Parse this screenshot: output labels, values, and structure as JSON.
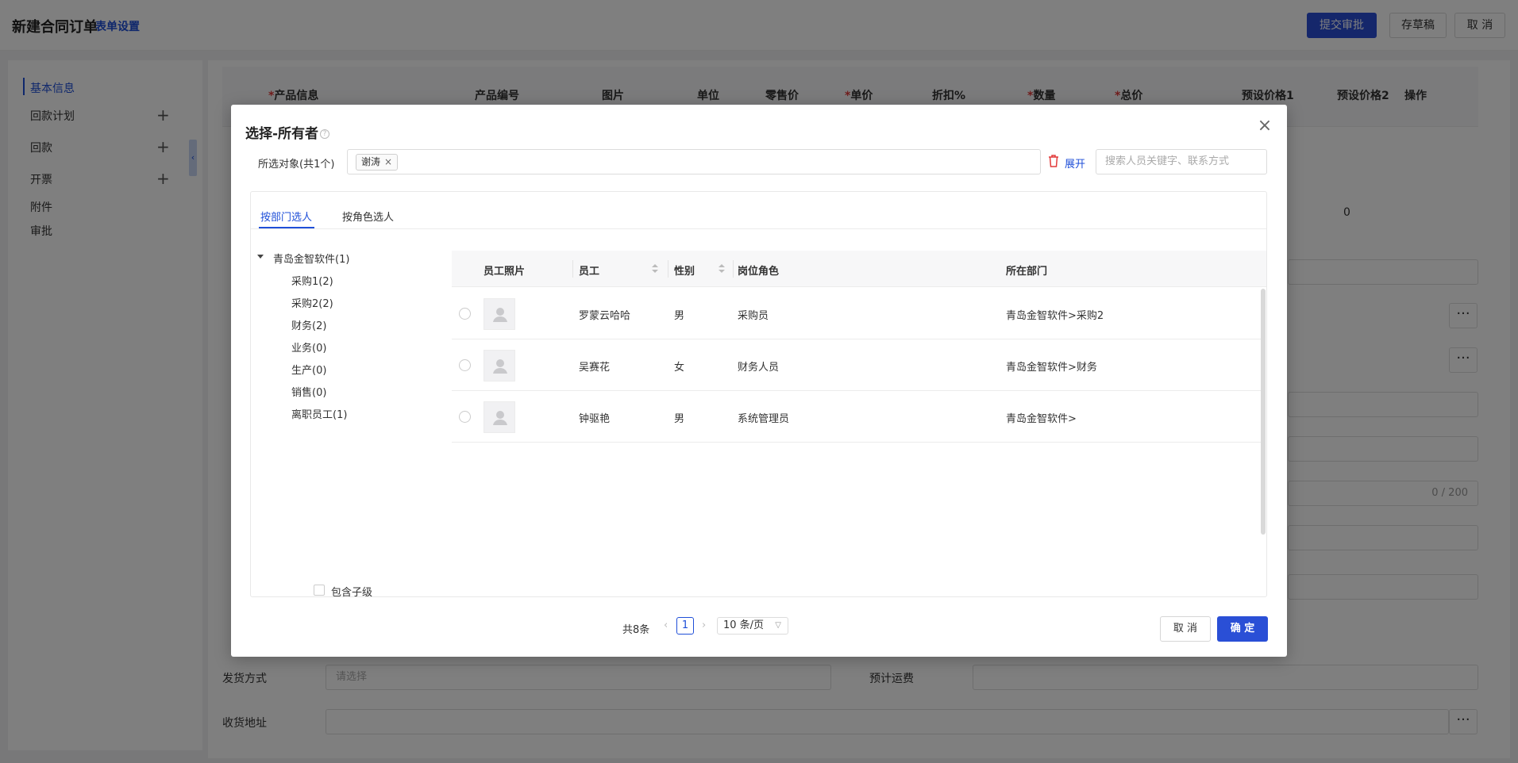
{
  "page": {
    "title": "新建合同订单",
    "form_settings": "表单设置",
    "actions": {
      "submit": "提交审批",
      "draft": "存草稿",
      "cancel": "取 消"
    }
  },
  "sidebar": {
    "items": [
      {
        "label": "基本信息",
        "active": true
      },
      {
        "label": "回款计划",
        "plus": true
      },
      {
        "label": "回款",
        "plus": true
      },
      {
        "label": "开票",
        "plus": true
      },
      {
        "label": "附件"
      },
      {
        "label": "审批"
      }
    ]
  },
  "product_table": {
    "headers": [
      "产品信息",
      "产品编号",
      "图片",
      "单位",
      "零售价",
      "单价",
      "折扣%",
      "数量",
      "总价",
      "预设价格1",
      "预设价格2",
      "操作"
    ],
    "row2_value": "0"
  },
  "background_form": {
    "shipping_method_label": "发货方式",
    "shipping_method_placeholder": "请选择",
    "estimated_freight_label": "预计运费",
    "receiving_address_label": "收货地址",
    "char_counter": "0 / 200"
  },
  "dialog": {
    "title": "选择-所有者",
    "selected_label": "所选对象(共1个)",
    "selected_tags": [
      "谢涛"
    ],
    "expand_label": "展开",
    "search_placeholder": "搜索人员关键字、联系方式",
    "tabs": [
      {
        "label": "按部门选人",
        "active": true
      },
      {
        "label": "按角色选人",
        "active": false
      }
    ],
    "tree": {
      "root": "青岛金智软件(1)",
      "children": [
        "采购1(2)",
        "采购2(2)",
        "财务(2)",
        "业务(0)",
        "生产(0)",
        "销售(0)",
        "离职员工(1)"
      ]
    },
    "include_children_label": "包含子级",
    "columns": [
      "员工照片",
      "员工",
      "性别",
      "岗位角色",
      "所在部门"
    ],
    "rows": [
      {
        "name": "罗蒙云哈哈",
        "gender": "男",
        "role": "采购员",
        "dept": "青岛金智软件>采购2"
      },
      {
        "name": "吴赛花",
        "gender": "女",
        "role": "财务人员",
        "dept": "青岛金智软件>财务"
      },
      {
        "name": "钟驱艳",
        "gender": "男",
        "role": "系统管理员",
        "dept": "青岛金智软件>"
      }
    ],
    "pagination": {
      "total": "共8条",
      "current": "1",
      "page_size": "10 条/页"
    },
    "buttons": {
      "cancel": "取 消",
      "ok": "确 定"
    }
  },
  "colors": {
    "primary": "#2a4fd6",
    "link": "#1f4fd8",
    "required": "#e23a3a"
  }
}
